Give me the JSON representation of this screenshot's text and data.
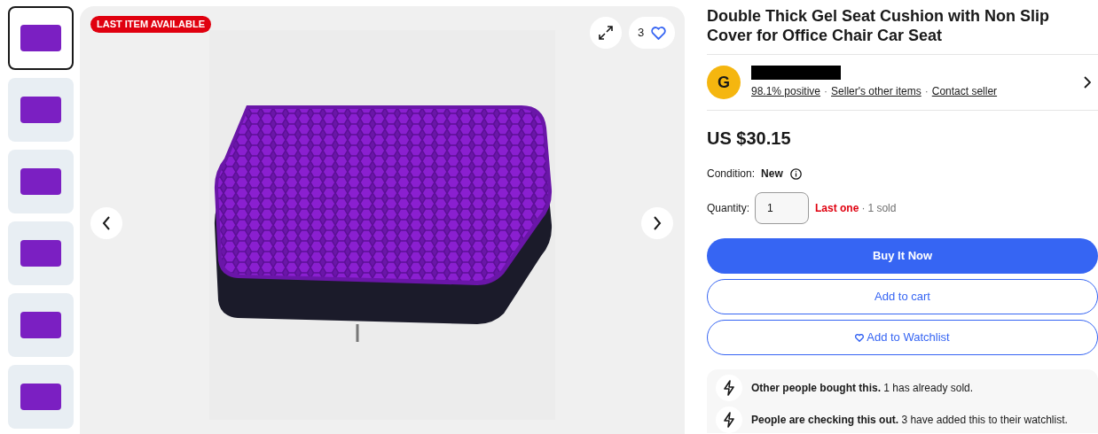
{
  "thumbnails": [
    {
      "selected": true
    },
    {
      "selected": false
    },
    {
      "selected": false
    },
    {
      "selected": false
    },
    {
      "selected": false
    },
    {
      "selected": false
    }
  ],
  "gallery": {
    "badge": "LAST ITEM AVAILABLE",
    "watch_count": "3"
  },
  "title": "Double Thick Gel Seat Cushion with Non Slip Cover for Office Chair Car Seat",
  "seller": {
    "avatar_letter": "G",
    "name_redacted": true,
    "separator": "·",
    "links": [
      "98.1% positive",
      "Seller's other items",
      "Contact seller"
    ]
  },
  "price": "US $30.15",
  "condition": {
    "label": "Condition:",
    "value": "New"
  },
  "quantity": {
    "label": "Quantity:",
    "value": "1",
    "stock": "Last one",
    "separator": "·",
    "sold": "1 sold"
  },
  "buttons": [
    {
      "label": "Buy It Now",
      "kind": "primary"
    },
    {
      "label": "Add to cart",
      "kind": "secondary"
    },
    {
      "label": "Add to Watchlist",
      "kind": "watch"
    }
  ],
  "signals": [
    "**Other people bought this.** 1 has already sold.",
    "**People are checking this out.** 3 have added this to their watchlist."
  ]
}
